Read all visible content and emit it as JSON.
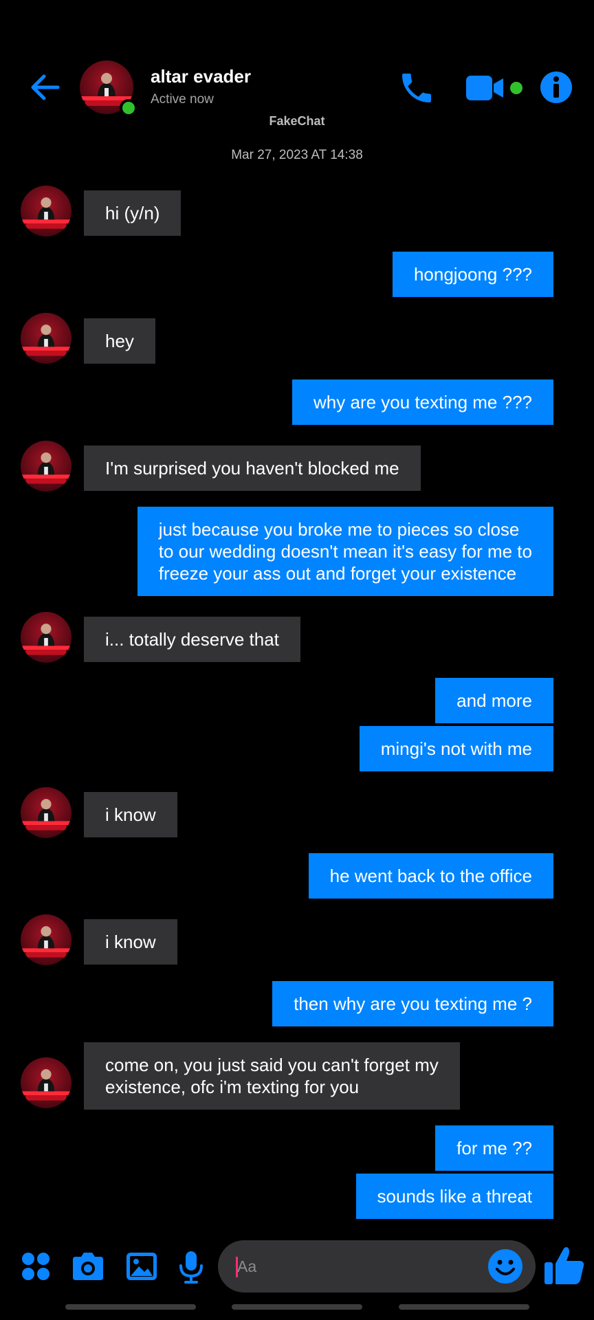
{
  "header": {
    "contact_name": "altar evader",
    "status": "Active now",
    "watermark": "FakeChat"
  },
  "conversation": {
    "timestamp": "Mar 27, 2023 AT 14:38"
  },
  "messages": [
    {
      "side": "in",
      "text": "hi (y/n)"
    },
    {
      "side": "out",
      "text": "hongjoong ???"
    },
    {
      "side": "in",
      "text": "hey"
    },
    {
      "side": "out",
      "text": "why are you texting me ???"
    },
    {
      "side": "in",
      "text": "I'm surprised you haven't blocked me"
    },
    {
      "side": "out",
      "text": "just because you broke me to pieces so close\nto our wedding doesn't mean it's easy for me to\nfreeze your ass out and forget your existence"
    },
    {
      "side": "in",
      "text": "i... totally deserve that"
    },
    {
      "side": "out",
      "text": "and more"
    },
    {
      "side": "out",
      "text": "mingi's not with me"
    },
    {
      "side": "in",
      "text": "i know"
    },
    {
      "side": "out",
      "text": "he went back to the office"
    },
    {
      "side": "in",
      "text": "i know"
    },
    {
      "side": "out",
      "text": "then why are you texting me ?"
    },
    {
      "side": "in",
      "text": "come on, you just said you can't forget my\nexistence, ofc i'm texting for you"
    },
    {
      "side": "out",
      "text": "for me ??"
    },
    {
      "side": "out",
      "text": "sounds like a threat"
    }
  ],
  "composer": {
    "placeholder": "Aa",
    "value": ""
  },
  "colors": {
    "accent": "#0084ff",
    "incoming_bubble": "#333335",
    "online": "#31c22b",
    "background": "#000000"
  },
  "icons": {
    "back": "arrow-left-icon",
    "phone": "phone-icon",
    "video": "video-camera-icon",
    "info": "info-icon",
    "apps": "apps-grid-icon",
    "camera": "camera-icon",
    "gallery": "image-icon",
    "mic": "microphone-icon",
    "emoji": "smiley-icon",
    "like": "thumbs-up-icon"
  }
}
